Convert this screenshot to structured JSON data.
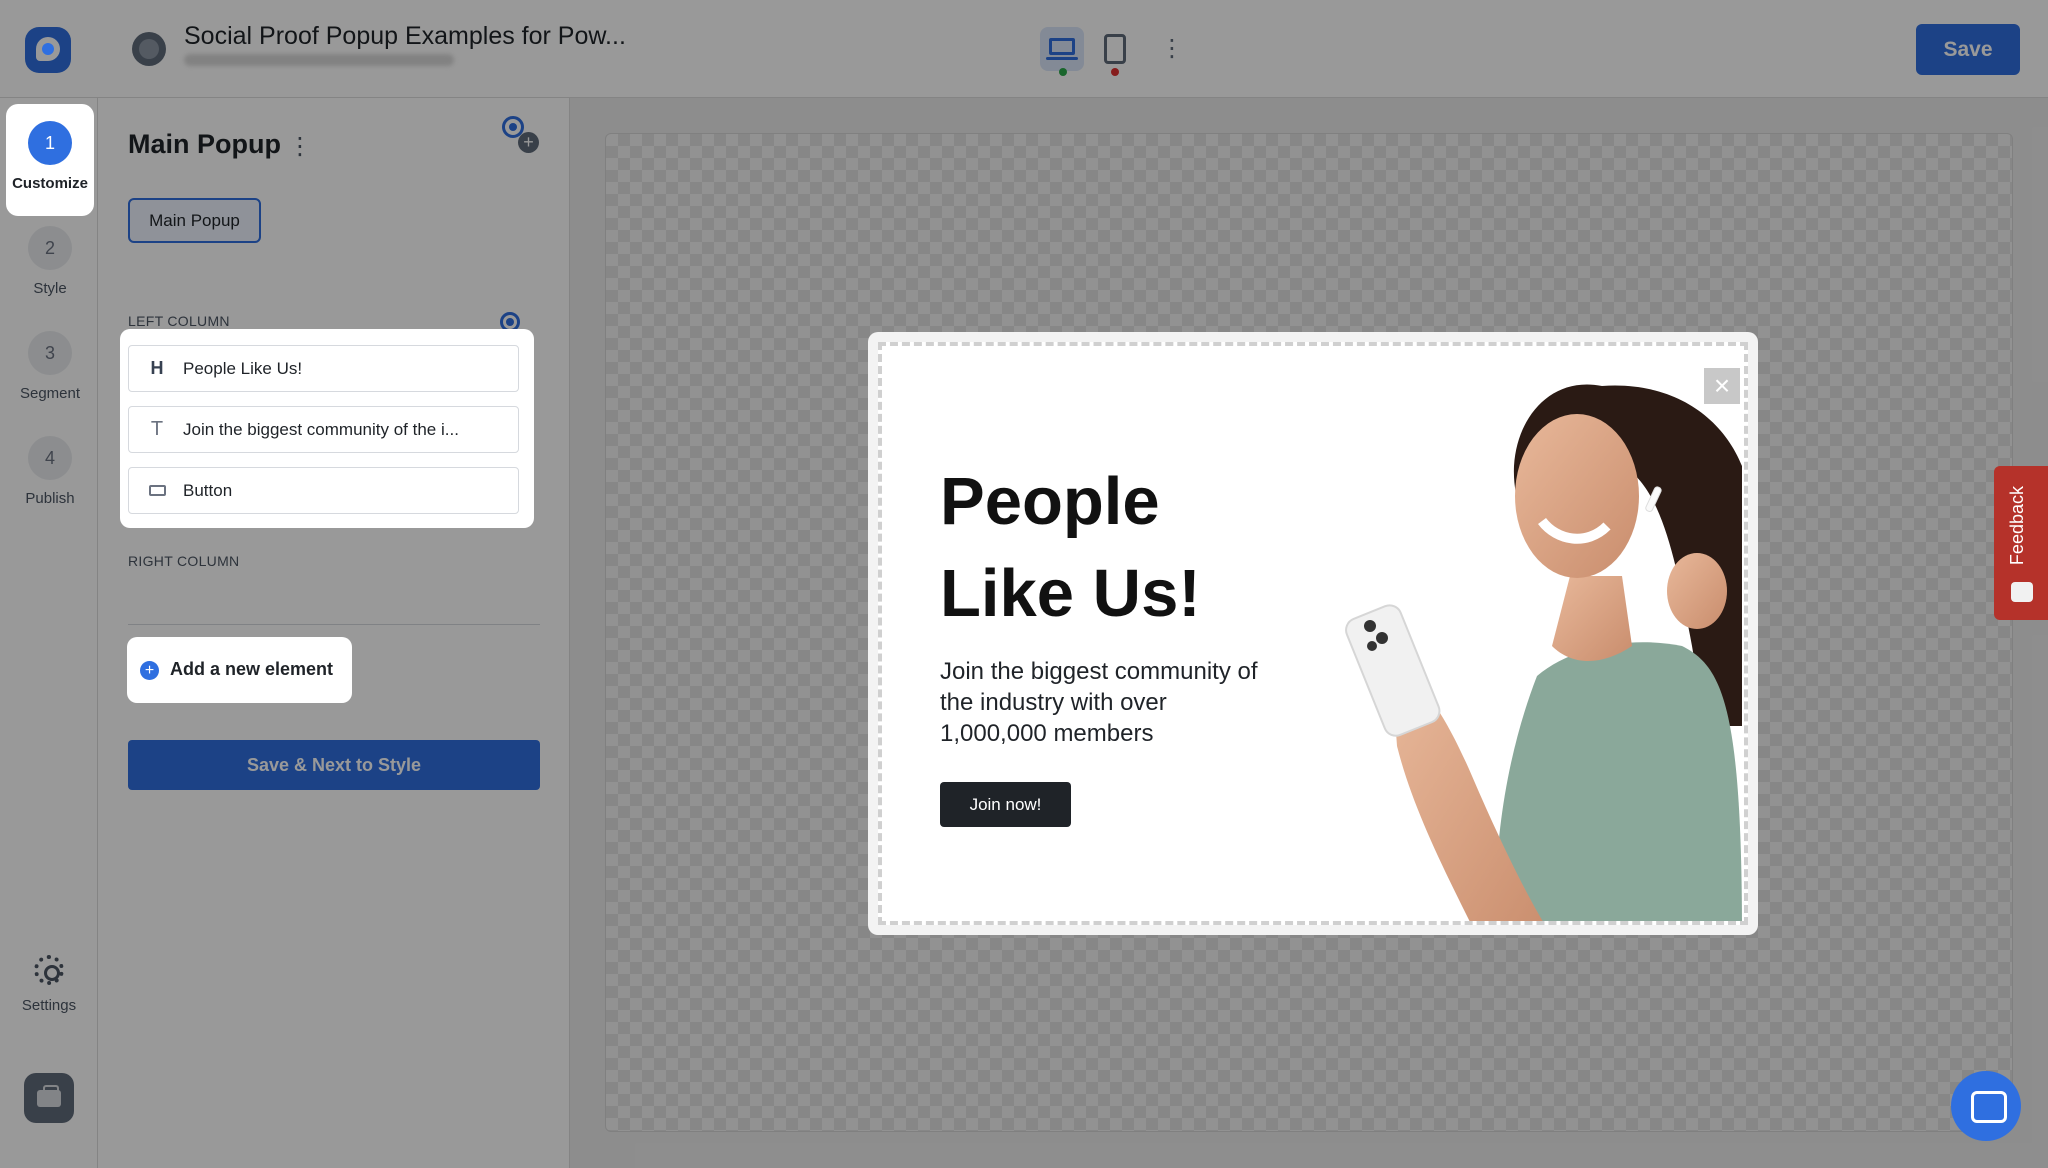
{
  "header": {
    "title": "Social Proof Popup Examples for Pow...",
    "save_label": "Save"
  },
  "steps": [
    {
      "number": "1",
      "label": "Customize",
      "active": true
    },
    {
      "number": "2",
      "label": "Style",
      "active": false
    },
    {
      "number": "3",
      "label": "Segment",
      "active": false
    },
    {
      "number": "4",
      "label": "Publish",
      "active": false
    }
  ],
  "rail": {
    "settings_label": "Settings"
  },
  "panel": {
    "title": "Main Popup",
    "variant_tab": "Main Popup",
    "left_column_label": "LEFT COLUMN",
    "right_column_label": "RIGHT COLUMN",
    "elements": [
      {
        "icon": "H",
        "label": "People Like Us!"
      },
      {
        "icon": "T",
        "label": "Join the biggest community of the i..."
      },
      {
        "icon": "button",
        "label": "Button"
      }
    ],
    "add_element_label": "Add a new element",
    "next_button_label": "Save & Next to Style"
  },
  "popup": {
    "headline": "People Like Us!",
    "body": "Join the biggest community of the industry with over 1,000,000 members",
    "cta_label": "Join now!",
    "close_glyph": "×"
  },
  "feedback": {
    "label": "Feedback"
  },
  "colors": {
    "accent": "#2f6fe0",
    "feedback": "#b5322a",
    "cta": "#1f2328"
  }
}
